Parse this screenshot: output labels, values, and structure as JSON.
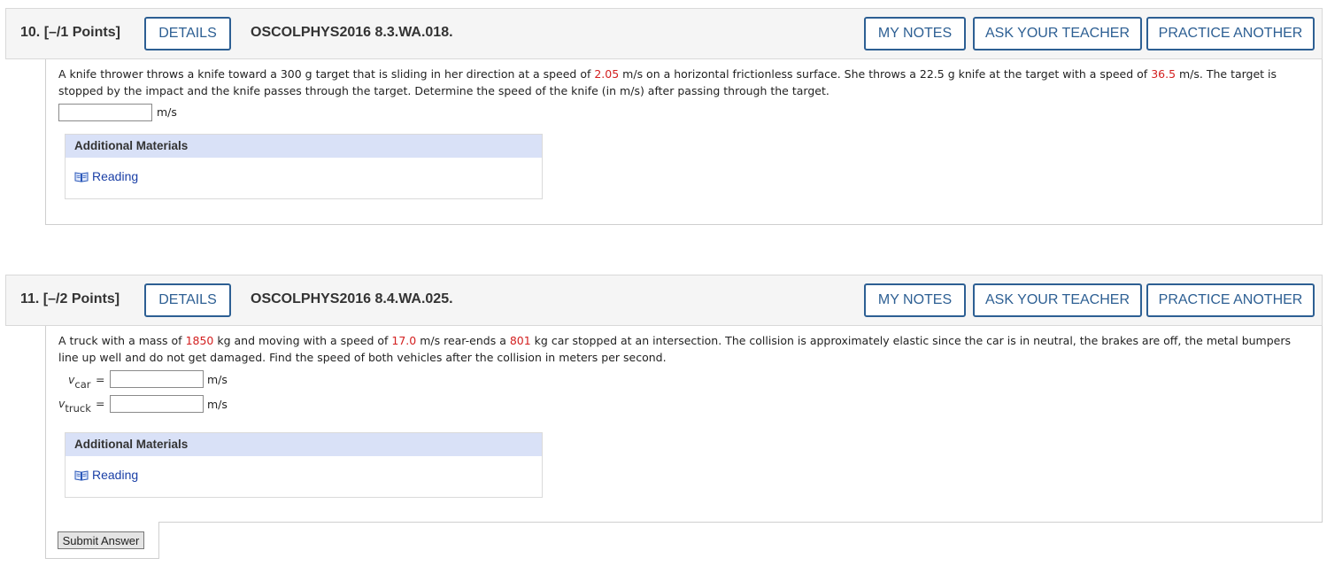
{
  "q10": {
    "number": "10. [–/1 Points]",
    "details_label": "DETAILS",
    "code": "OSCOLPHYS2016 8.3.WA.018.",
    "my_notes_label": "MY NOTES",
    "ask_label": "ASK YOUR TEACHER",
    "practice_label": "PRACTICE ANOTHER",
    "text_1": "A knife thrower throws a knife toward a 300 g target that is sliding in her direction at a speed of ",
    "val_1": "2.05",
    "text_2": " m/s on a horizontal frictionless surface. She throws a 22.5 g knife at the target with a speed of ",
    "val_2": "36.5",
    "text_3": " m/s. The target is stopped by the impact and the knife passes through the target. Determine the speed of the knife (in m/s) after passing through the target.",
    "answer_value": "",
    "unit": "m/s",
    "additional_materials": "Additional Materials",
    "reading": "Reading"
  },
  "q11": {
    "number": "11. [–/2 Points]",
    "details_label": "DETAILS",
    "code": "OSCOLPHYS2016 8.4.WA.025.",
    "my_notes_label": "MY NOTES",
    "ask_label": "ASK YOUR TEACHER",
    "practice_label": "PRACTICE ANOTHER",
    "text_1": "A truck with a mass of ",
    "val_1": "1850",
    "text_2": " kg and moving with a speed of ",
    "val_2": "17.0",
    "text_3": " m/s rear-ends a ",
    "val_3": "801",
    "text_4": " kg car stopped at an intersection. The collision is approximately elastic since the car is in neutral, the brakes are off, the metal bumpers line up well and do not get damaged. Find the speed of both vehicles after the collision in meters per second.",
    "var1_main": "v",
    "var1_sub": "car",
    "var2_main": "v",
    "var2_sub": "truck",
    "eq": "=",
    "unit": "m/s",
    "answer1_value": "",
    "answer2_value": "",
    "additional_materials": "Additional Materials",
    "reading": "Reading"
  },
  "submit_label": "Submit Answer"
}
